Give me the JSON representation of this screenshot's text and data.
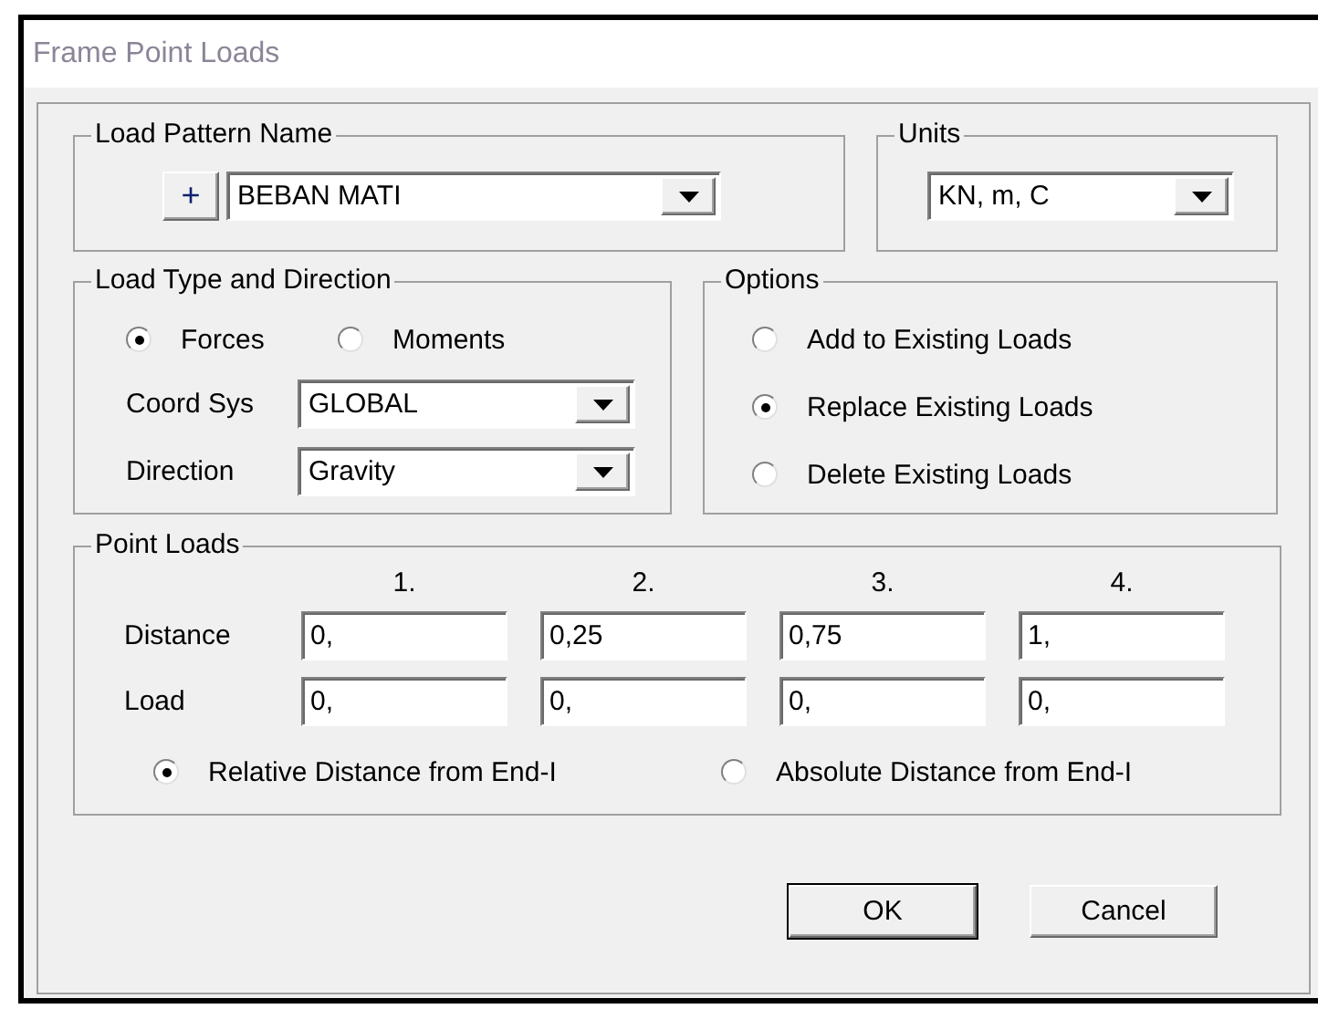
{
  "window": {
    "title": "Frame Point Loads"
  },
  "load_pattern": {
    "title": "Load Pattern Name",
    "add_button": "+",
    "value": "BEBAN MATI"
  },
  "units": {
    "title": "Units",
    "value": "KN, m, C"
  },
  "load_type": {
    "title": "Load Type and Direction",
    "types": [
      {
        "label": "Forces",
        "selected": true
      },
      {
        "label": "Moments",
        "selected": false
      }
    ],
    "coord_sys": {
      "label": "Coord Sys",
      "value": "GLOBAL"
    },
    "direction": {
      "label": "Direction",
      "value": "Gravity"
    }
  },
  "options": {
    "title": "Options",
    "items": [
      {
        "label": "Add to Existing Loads",
        "selected": false
      },
      {
        "label": "Replace Existing Loads",
        "selected": true
      },
      {
        "label": "Delete Existing Loads",
        "selected": false
      }
    ]
  },
  "point_loads": {
    "title": "Point Loads",
    "columns": [
      "1.",
      "2.",
      "3.",
      "4."
    ],
    "rows": [
      {
        "label": "Distance",
        "values": [
          "0,",
          "0,25",
          "0,75",
          "1,"
        ]
      },
      {
        "label": "Load",
        "values": [
          "0,",
          "0,",
          "0,",
          "0,"
        ]
      }
    ],
    "distance_modes": [
      {
        "label": "Relative Distance from End-I",
        "selected": true
      },
      {
        "label": "Absolute Distance from End-I",
        "selected": false
      }
    ]
  },
  "buttons": [
    "OK",
    "Cancel"
  ]
}
